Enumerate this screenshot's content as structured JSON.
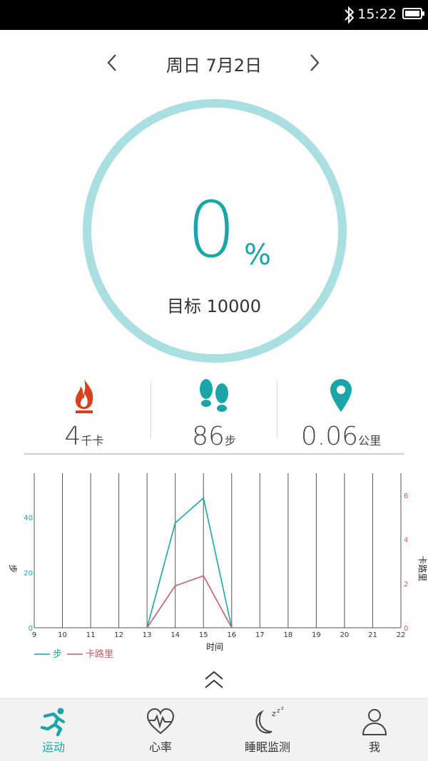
{
  "status_bar": {
    "time": "15:22"
  },
  "header": {
    "date": "周日  7月2日"
  },
  "progress": {
    "percent_number": "0",
    "percent_sign": "%",
    "goal_label": "目标 10000"
  },
  "stats": [
    {
      "value": "4",
      "unit": "千卡",
      "icon": "fire-icon"
    },
    {
      "value": "86",
      "unit": "步",
      "icon": "footprints-icon"
    },
    {
      "value": "0.06",
      "unit": "公里",
      "icon": "location-pin-icon"
    }
  ],
  "chart_data": {
    "type": "line",
    "x": [
      9,
      10,
      11,
      12,
      13,
      14,
      15,
      16,
      17,
      18,
      19,
      20,
      21,
      22
    ],
    "xlabel": "时间",
    "y_left_label": "步",
    "y_right_label": "卡路里",
    "y_left_ticks": [
      "0",
      "20",
      "40"
    ],
    "y_right_ticks": [
      "0",
      "2",
      "4",
      "6"
    ],
    "ylim_left": [
      0,
      56
    ],
    "ylim_right": [
      0,
      7
    ],
    "series": [
      {
        "name": "步",
        "axis": "left",
        "color": "#1aa6a8",
        "x": [
          13,
          14,
          15,
          16
        ],
        "values": [
          0,
          38,
          47,
          0
        ]
      },
      {
        "name": "卡路里",
        "axis": "right",
        "color": "#c0616b",
        "x": [
          13,
          14,
          15,
          16
        ],
        "values": [
          0,
          1.9,
          2.35,
          0
        ]
      }
    ],
    "legend": [
      "步",
      "卡路里"
    ],
    "legend_position": "bottom-left",
    "grid": true
  },
  "tabs": [
    {
      "label": "运动",
      "icon": "running-icon",
      "active": true
    },
    {
      "label": "心率",
      "icon": "heart-rate-icon",
      "active": false
    },
    {
      "label": "睡眠监测",
      "icon": "sleep-moon-icon",
      "active": false
    },
    {
      "label": "我",
      "icon": "person-icon",
      "active": false
    }
  ],
  "colors": {
    "accent": "#1aa6a8",
    "ring": "#a9dfe0",
    "calorie": "#c0616b",
    "fire": "#d9401f"
  }
}
